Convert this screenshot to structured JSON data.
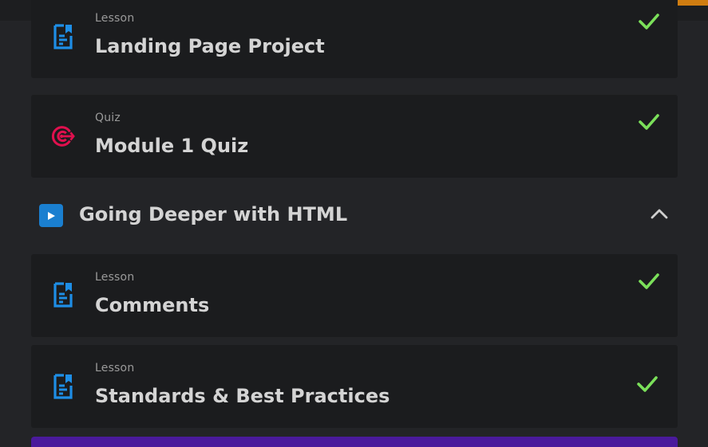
{
  "items_top": [
    {
      "kind": "Lesson",
      "title": "Landing Page Project",
      "icon": "lesson-doc-icon",
      "completed": true
    },
    {
      "kind": "Quiz",
      "title": "Module 1 Quiz",
      "icon": "quiz-target-icon",
      "completed": true
    }
  ],
  "section": {
    "title": "Going Deeper with HTML",
    "icon": "play-icon",
    "expanded": true
  },
  "items_bottom": [
    {
      "kind": "Lesson",
      "title": "Comments",
      "icon": "lesson-doc-icon",
      "completed": true
    },
    {
      "kind": "Lesson",
      "title": "Standards & Best Practices",
      "icon": "lesson-doc-icon",
      "completed": true
    }
  ],
  "colors": {
    "background": "#232427",
    "card": "#1b1c1e",
    "lesson_icon": "#1e8ee6",
    "quiz_icon": "#e0104e",
    "check": "#7be05a",
    "section_icon": "#1a7fd0",
    "orange_accent": "#d07d11",
    "purple_bar": "#4a1a9c"
  }
}
